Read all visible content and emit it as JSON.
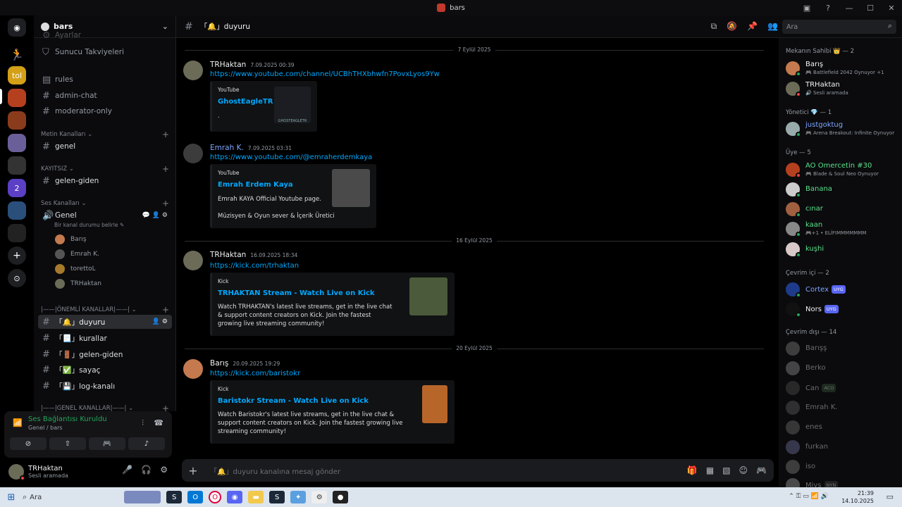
{
  "window": {
    "title": "bars"
  },
  "guild": {
    "name": "bars"
  },
  "channels": {
    "top_partial": "Ayarlar",
    "boosts": "Sunucu Takviyeleri",
    "rules": "rules",
    "admin": "admin-chat",
    "moderator": "moderator-only",
    "text_category": "Metin Kanalları",
    "genel": "genel",
    "unregistered_category": "KAYITSIZ",
    "gelen_giden": "gelen-giden",
    "voice_category": "Ses Kanalları",
    "voice_genel": "Genel",
    "voice_status_hint": "Bir kanal durumu belirle",
    "voice_users": [
      "Barış",
      "Emrah K.",
      "torettoL",
      "TRHaktan"
    ],
    "important_category": "|——|ÖNEMLİ KANALLAR|——|",
    "important": [
      "「🔔」duyuru",
      "「📃」kurallar",
      "「🚪」gelen-giden",
      "「✅」sayaç",
      "「💾」log-kanalı"
    ],
    "general_category": "|——|GENEL KANALLAR|——|"
  },
  "voice_panel": {
    "status": "Ses Bağlantısı Kuruldu",
    "location": "Genel / bars"
  },
  "user_panel": {
    "name": "TRHaktan",
    "status": "Sesli aramada"
  },
  "chat": {
    "channel": "「🔔」duyuru",
    "search_placeholder": "Ara",
    "composer_placeholder": "「🔔」duyuru kanalına mesaj gönder",
    "dividers": [
      "7 Eylül 2025",
      "16 Eylül 2025",
      "20 Eylül 2025"
    ],
    "messages": [
      {
        "author": "TRHaktan",
        "time": "7.09.2025 00:39",
        "link": "https://www.youtube.com/channel/UCBhTHXbhwfn7PovxLyos9Yw",
        "embed": {
          "provider": "YouTube",
          "title": "GhostEagleTR",
          "desc": ".",
          "thumb_text": "GHOSTEAGLETR"
        }
      },
      {
        "author": "Emrah K.",
        "time": "7.09.2025 03:31",
        "link": "https://www.youtube.com/@emraherdemkaya",
        "embed": {
          "provider": "YouTube",
          "title": "Emrah Erdem Kaya",
          "desc": "Emrah KAYA Official Youtube page.",
          "desc2": "Müzisyen & Oyun sever & İçerik Üretici"
        }
      },
      {
        "author": "TRHaktan",
        "time": "16.09.2025 18:34",
        "link": "https://kick.com/trhaktan",
        "embed": {
          "provider": "Kick",
          "title": "TRHAKTAN Stream - Watch Live on Kick",
          "desc": "Watch TRHAKTAN's latest live streams, get in the live chat & support content creators on Kick. Join the fastest growing live streaming community!"
        }
      },
      {
        "author": "Barış",
        "time": "20.09.2025 19:29",
        "link": "https://kick.com/baristokr",
        "embed": {
          "provider": "Kick",
          "title": "Baristokr Stream - Watch Live on Kick",
          "desc": "Watch Baristokr's latest live streams, get in the live chat & support content creators on Kick. Join the fastest growing live streaming community!"
        }
      }
    ]
  },
  "members": {
    "owner_cat": "Mekanın Sahibi 👑 — 2",
    "owners": [
      {
        "name": "Barış",
        "act": "🎮 Battlefield 2042 Oynuyor +1"
      },
      {
        "name": "TRHaktan",
        "act": "🔊 Sesli aramada"
      }
    ],
    "admin_cat": "Yönetici 💎 — 1",
    "admins": [
      {
        "name": "justgoktug",
        "act": "🎮 Arena Breakout: Infinite Oynuyor"
      }
    ],
    "member_cat": "Üye — 5",
    "users": [
      {
        "name": "AO Omercetin #30",
        "act": "🎮 Blade & Soul Neo Oynuyor"
      },
      {
        "name": "Banana",
        "act": ""
      },
      {
        "name": "cınar",
        "act": ""
      },
      {
        "name": "kaan",
        "act": "🎮+1 • ELİFIMMMMMMM"
      },
      {
        "name": "kuşhi",
        "act": ""
      }
    ],
    "online_cat": "Çevrim içi — 2",
    "online": [
      {
        "name": "Cortex",
        "badge": "UYG"
      },
      {
        "name": "Nors",
        "badge": "UYG"
      }
    ],
    "offline_cat": "Çevrim dışı — 14",
    "offline": [
      "Barışş",
      "Berko",
      "Can",
      "Emrah K.",
      "enes",
      "furkan",
      "iso",
      "Miys"
    ],
    "offline_badges": {
      "Can": "ACO",
      "Miys": "NYN"
    }
  },
  "taskbar": {
    "search": "Ara",
    "time": "21:39",
    "date": "14.10.2025"
  },
  "colors": {
    "accent": "#5865f2",
    "link": "#00a8fc",
    "online": "#23a55a",
    "background": "#000000"
  }
}
